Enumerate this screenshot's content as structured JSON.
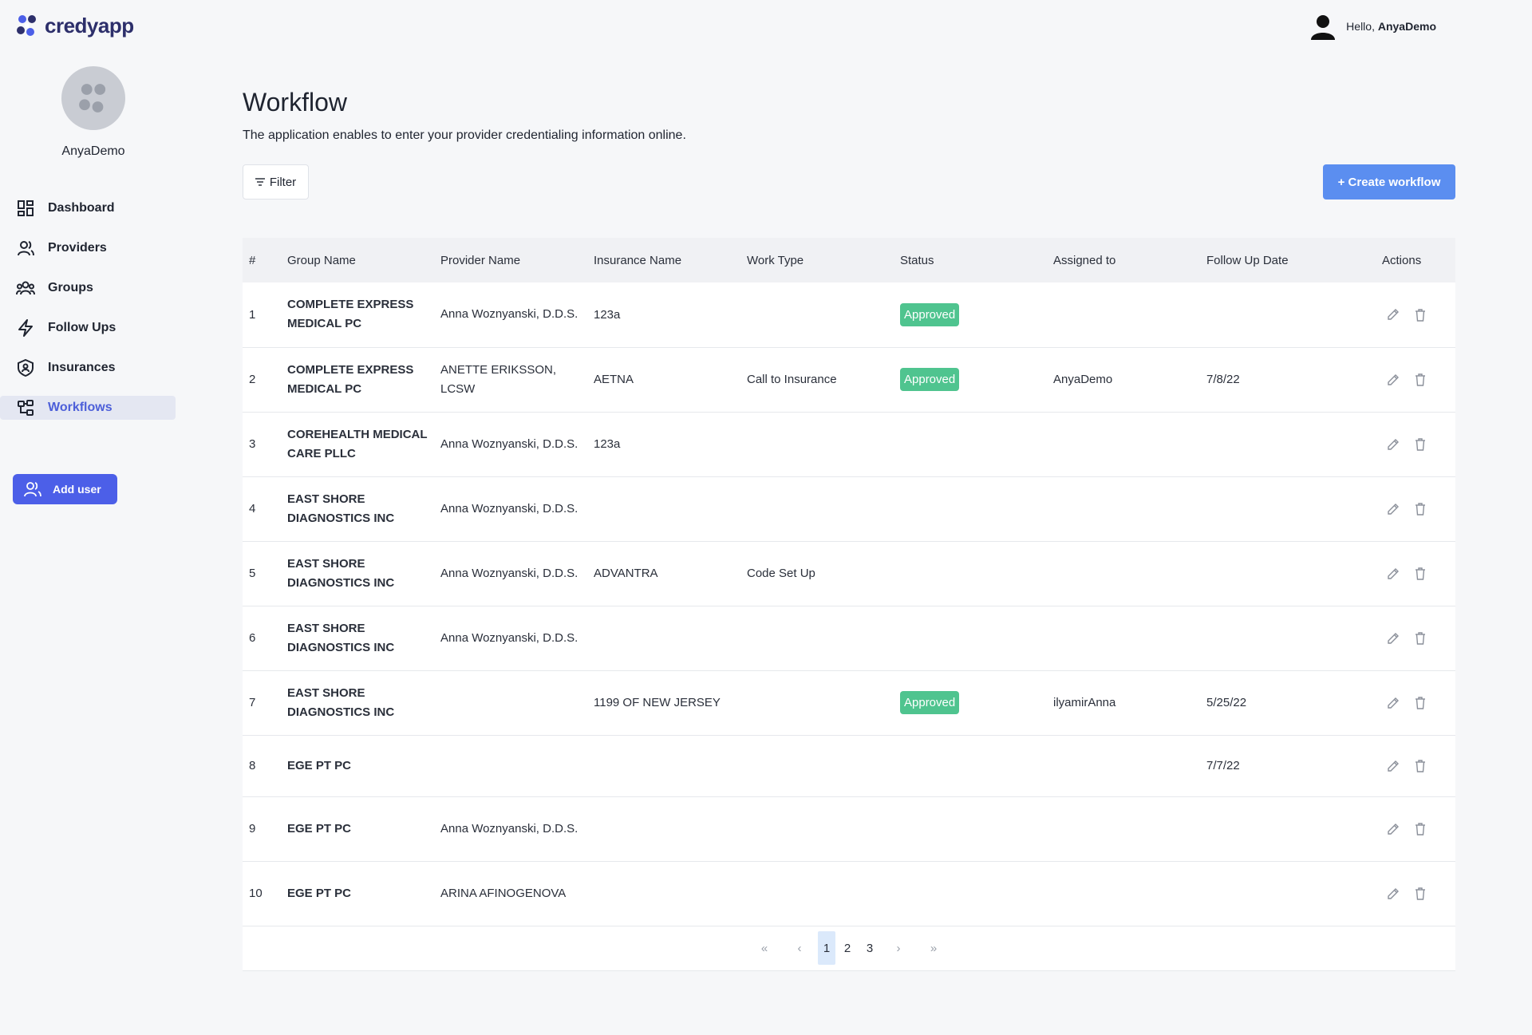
{
  "app": {
    "logo_text": "credyapp"
  },
  "header": {
    "greeting": "Hello,",
    "username": "AnyaDemo"
  },
  "sidebar": {
    "username": "AnyaDemo",
    "items": [
      {
        "label": "Dashboard",
        "icon": "grid-icon"
      },
      {
        "label": "Providers",
        "icon": "user-icon"
      },
      {
        "label": "Groups",
        "icon": "users-icon"
      },
      {
        "label": "Follow Ups",
        "icon": "bolt-icon"
      },
      {
        "label": "Insurances",
        "icon": "shield-icon"
      },
      {
        "label": "Workflows",
        "icon": "workflow-icon",
        "active": true
      }
    ],
    "add_user_label": "Add user"
  },
  "main": {
    "title": "Workflow",
    "subtitle": "The application enables to enter your provider credentialing information online.",
    "filter_label": "Filter",
    "create_label": "+ Create workflow"
  },
  "table": {
    "headers": [
      "#",
      "Group Name",
      "Provider Name",
      "Insurance Name",
      "Work Type",
      "Status",
      "Assigned to",
      "Follow Up Date",
      "Actions"
    ],
    "rows": [
      {
        "num": "1",
        "group": "COMPLETE EXPRESS MEDICAL PC",
        "provider": "Anna Woznyanski, D.D.S.",
        "insurance": "123a",
        "work_type": "",
        "status": "Approved",
        "assigned": "",
        "follow_up": ""
      },
      {
        "num": "2",
        "group": "COMPLETE EXPRESS MEDICAL PC",
        "provider": "ANETTE ERIKSSON, LCSW",
        "insurance": "AETNA",
        "work_type": "Call to Insurance",
        "status": "Approved",
        "assigned": "AnyaDemo",
        "follow_up": "7/8/22"
      },
      {
        "num": "3",
        "group": "COREHEALTH MEDICAL CARE PLLC",
        "provider": "Anna Woznyanski, D.D.S.",
        "insurance": "123a",
        "work_type": "",
        "status": "",
        "assigned": "",
        "follow_up": ""
      },
      {
        "num": "4",
        "group": "EAST SHORE DIAGNOSTICS INC",
        "provider": "Anna Woznyanski, D.D.S.",
        "insurance": "",
        "work_type": "",
        "status": "",
        "assigned": "",
        "follow_up": ""
      },
      {
        "num": "5",
        "group": "EAST SHORE DIAGNOSTICS INC",
        "provider": "Anna Woznyanski, D.D.S.",
        "insurance": "ADVANTRA",
        "work_type": "Code Set Up",
        "status": "",
        "assigned": "",
        "follow_up": ""
      },
      {
        "num": "6",
        "group": "EAST SHORE DIAGNOSTICS INC",
        "provider": "Anna Woznyanski, D.D.S.",
        "insurance": "",
        "work_type": "",
        "status": "",
        "assigned": "",
        "follow_up": ""
      },
      {
        "num": "7",
        "group": "EAST SHORE DIAGNOSTICS INC",
        "provider": "",
        "insurance": "1199 OF NEW JERSEY",
        "work_type": "",
        "status": "Approved",
        "assigned": "ilyamirAnna",
        "follow_up": "5/25/22"
      },
      {
        "num": "8",
        "group": "EGE PT PC",
        "provider": "",
        "insurance": "",
        "work_type": "",
        "status": "",
        "assigned": "",
        "follow_up": "7/7/22"
      },
      {
        "num": "9",
        "group": "EGE PT PC",
        "provider": "Anna Woznyanski, D.D.S.",
        "insurance": "",
        "work_type": "",
        "status": "",
        "assigned": "",
        "follow_up": ""
      },
      {
        "num": "10",
        "group": "EGE PT PC",
        "provider": "ARINA AFINOGENOVA",
        "insurance": "",
        "work_type": "",
        "status": "",
        "assigned": "",
        "follow_up": ""
      }
    ]
  },
  "pagination": {
    "first": "«",
    "prev": "‹",
    "pages": [
      "1",
      "2",
      "3"
    ],
    "current": "1",
    "next": "›",
    "last": "»"
  },
  "colors": {
    "accent": "#4c5fe8",
    "create": "#5b8ef0",
    "approved": "#4fc48f",
    "active_nav_bg": "#e4e7f2"
  }
}
